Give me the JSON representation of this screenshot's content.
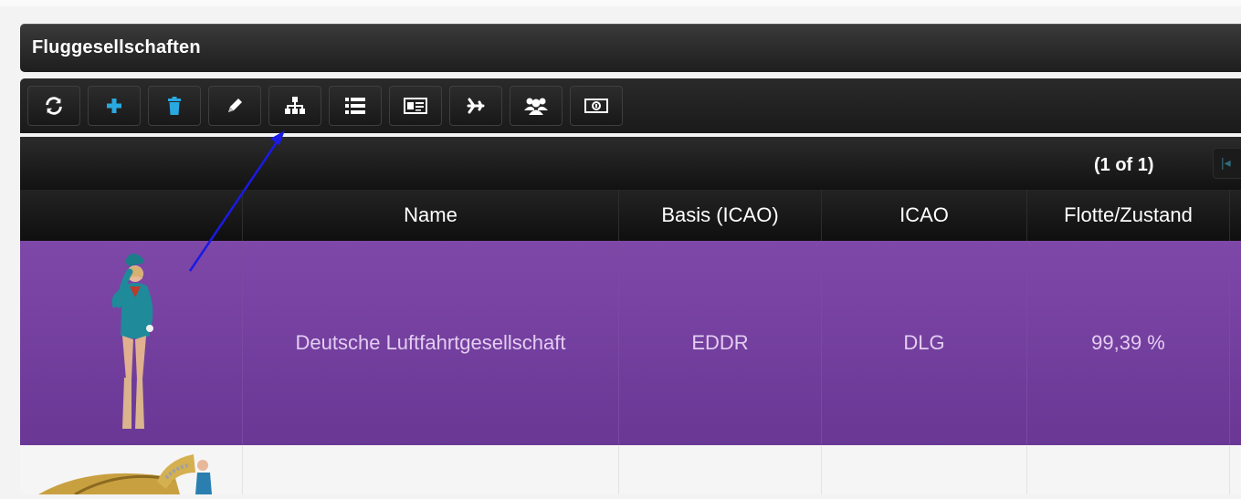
{
  "window": {
    "title": "Fluggesellschaften"
  },
  "toolbar": {
    "buttons": [
      {
        "icon": "refresh-icon"
      },
      {
        "icon": "plus-icon"
      },
      {
        "icon": "trash-icon"
      },
      {
        "icon": "pencil-icon"
      },
      {
        "icon": "sitemap-icon"
      },
      {
        "icon": "list-icon"
      },
      {
        "icon": "id-card-icon"
      },
      {
        "icon": "plane-icon"
      },
      {
        "icon": "users-icon"
      },
      {
        "icon": "money-icon"
      }
    ]
  },
  "pager": {
    "info": "(1 of 1)"
  },
  "table": {
    "columns": [
      "",
      "Name",
      "Basis (ICAO)",
      "ICAO",
      "Flotte/Zustand"
    ],
    "rows": [
      {
        "image": "flight-attendant-image",
        "name": "Deutsche Luftfahrtgesellschaft",
        "basis": "EDDR",
        "icao": "DLG",
        "flotte": "99,39 %"
      }
    ]
  },
  "colors": {
    "accent": "#29a9e0",
    "row_selected": "#7a44a3",
    "annotation_arrow": "#1a1ae6"
  }
}
